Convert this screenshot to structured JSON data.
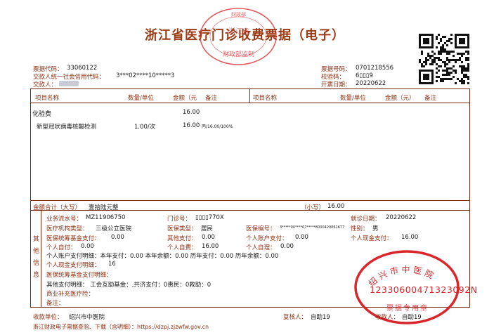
{
  "header": {
    "title": "浙江省医疗门诊收费票据（电子）"
  },
  "top_stamp": {
    "text_top": "财政部",
    "text_mid": "浙江省",
    "text_bottom": "财政部监制"
  },
  "meta_left": {
    "code_label": "票据代码：",
    "code": "33060122",
    "credit_label": "交款人统一社会信用代码：",
    "credit": "3***02****10*****3",
    "payer_label": "交款人："
  },
  "meta_right": {
    "number_label": "票据号码：",
    "number": "0701218556",
    "check_label": "校验码：",
    "check": "6▯▯▯9",
    "date_label": "开票日期：",
    "date": "20220622"
  },
  "table_header": {
    "item": "项目名称",
    "qty": "数量/单位",
    "amount": "金额（元",
    "note": "备注",
    "item2": "项目名称",
    "qty2": "数量/单位",
    "amount2": "金额（元）",
    "note2": "备注"
  },
  "items": {
    "category": "化验费",
    "category_amount": "16.00",
    "row_name": "新型冠状病毒核酸检测",
    "row_qty": "1.00/次",
    "row_amount": "16.00",
    "row_note": "丙/16.00/100%"
  },
  "total": {
    "label": "金额合计（大写）",
    "upper": "壹拾陆元整",
    "small_label": "（小写）",
    "small": "16.00"
  },
  "other_info": {
    "side": [
      "其",
      "他",
      "信",
      "息"
    ],
    "serial_label": "业务流水号：",
    "serial": "MZ11906750",
    "clinic_label": "门诊号：",
    "clinic": "▯▯▯▯770X",
    "visit_date_label": "就诊日期：",
    "visit_date": "20220622",
    "org_type_label": "医疗机构类型：",
    "org_type": "三级公立医院",
    "ins_type_label": "医保类型：",
    "ins_type": "居民",
    "ins_no_label": "医保编号：",
    "ins_no": "3*****00****67*****8000420061677",
    "gender_label": "性别：",
    "gender": "男",
    "fund_label": "医保统筹基金支付：",
    "fund": "0.00",
    "other_pay_label": "其他支付：",
    "other_pay": "0.00",
    "acct_pay_label": "个人账户支付：",
    "acct_pay": "0.00",
    "cash_pay_label": "个人现金支付：",
    "cash_pay": "16.00",
    "self_pay_label": "个人自付：",
    "self_pay": "0.00",
    "self_cost_label": "个人自费：",
    "self_cost": "16.00",
    "self_burden_label": "个人自理：",
    "self_burden": "0.00",
    "acct_detail": "个人账户支付明细：本年支付：0.00 本年余额：0.00 历年支付：0.00 历年余额：0.00",
    "cash_detail_label": "个人现金支付明细：",
    "cash_detail": "16",
    "fund_detail": "医保统筹基金支付明细：",
    "other_detail": "其他支付明细：  工会互助基金：,共济支付：0惠民：0救助：0",
    "commercial": "商业补充医疗险：",
    "remark": "备注："
  },
  "footer": {
    "payee_label": "收款单位：",
    "payee": "绍兴市中医院",
    "reviewer_label": "复核人：",
    "reviewer": "自助19",
    "cashier_label": "收款人：",
    "cashier": "自助19",
    "url_line": "浙江财政电子票据查验、下载（含明细）：https://dzpj.zjzwfw.gov.cn"
  },
  "hospital_stamp": {
    "top": "绍兴市中医院",
    "code": "12330600471323092N",
    "bottom": "票据专用章"
  },
  "colors": {
    "label": "#8e2f10",
    "stamp": "#d9262a",
    "frame": "#7a2a10"
  }
}
